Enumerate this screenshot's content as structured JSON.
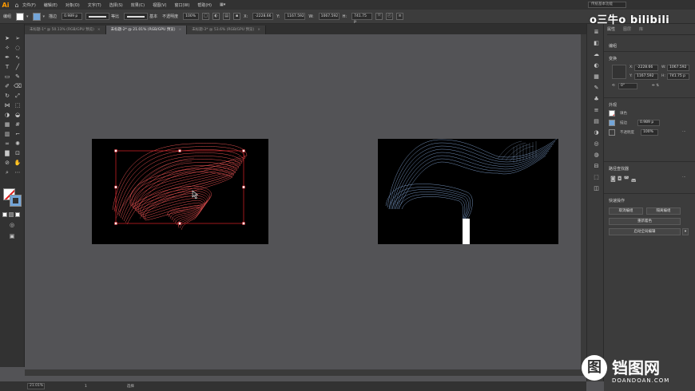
{
  "app": {
    "logo": "Ai",
    "home_icon": "home-icon",
    "menus": [
      "文件(F)",
      "编辑(E)",
      "对象(O)",
      "文字(T)",
      "选择(S)",
      "效果(C)",
      "视图(V)",
      "窗口(W)",
      "帮助(H)"
    ],
    "workspace": "传统基本功能"
  },
  "control_bar": {
    "selection_label": "编组",
    "stroke_label": "描边",
    "stroke_value": "0.989 p",
    "stroke_style_label": "等比",
    "stroke_profile_label": "基本",
    "opacity_label": "不透明度",
    "opacity_value": "100%",
    "x_value": "-2228.66",
    "y_value": "1167.592",
    "w_value": "1067.592",
    "h_value": "741.75 p"
  },
  "tabs": [
    {
      "label": "未标题-1* @ 50.13% (RGB/GPU 预览)"
    },
    {
      "label": "未标题-2* @ 21.01% (RGB/GPU 预览)"
    },
    {
      "label": "未标题-3* @ 53.6% (RGB/GPU 预览)"
    }
  ],
  "status": {
    "zoom": "21.01%",
    "page": "1",
    "tool": "选择"
  },
  "panel": {
    "tabs": [
      "属性",
      "图层",
      "库"
    ],
    "group_label": "编组",
    "transform_label": "变换",
    "x": "-2228.66",
    "y": "1167.592",
    "w": "1067.592",
    "h": "741.75 p",
    "rotation": "0°",
    "appearance_label": "外观",
    "fill_label": "填色",
    "stroke_label": "描边",
    "stroke_value": "0.989 p",
    "opacity_label": "不透明度",
    "opacity_value": "100%",
    "pathfinder_label": "路径查找器",
    "quick_actions_label": "快速操作",
    "ungroup_btn": "取消编组",
    "isolate_btn": "隔离编组",
    "recolor_btn": "重新着色",
    "align_btn": "启动全局编辑"
  },
  "colors": {
    "red_blend": "#ff5a5a",
    "blue_blend": "#8fb4e8",
    "selection": "#e0222a"
  },
  "watermarks": {
    "top": "o三牛o bilibili",
    "bottom_icon": "图",
    "bottom_text": "铛图网",
    "bottom_sub": "DOANDOAN.COM"
  }
}
